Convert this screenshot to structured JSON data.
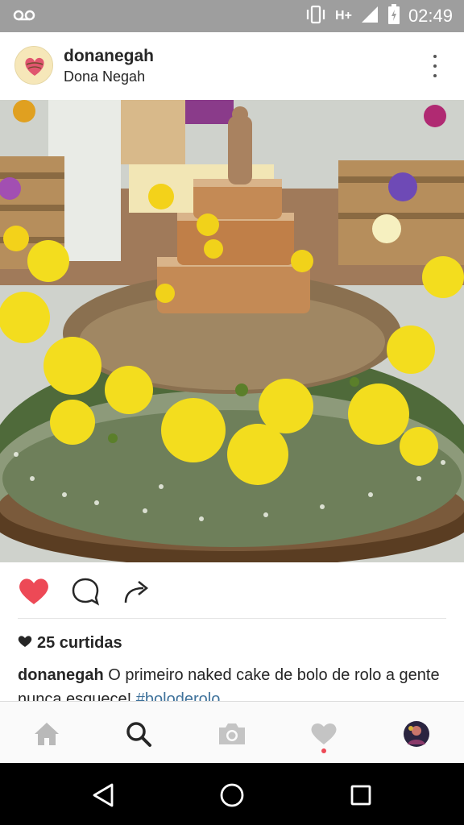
{
  "status_bar": {
    "network": "H+",
    "time": "02:49",
    "icons": [
      "voicemail-icon",
      "vibrate-icon",
      "signal-icon",
      "battery-icon"
    ]
  },
  "post": {
    "username": "donanegah",
    "full_name": "Dona Negah",
    "photo_icon": "cake-photo",
    "liked": true,
    "likes_text": "25 curtidas",
    "caption_user": "donanegah",
    "caption_text": " O primeiro naked cake de bolo de rolo a gente nunca esquece! ",
    "caption_hashtag": "#bolodero​lo"
  },
  "bottom_nav": {
    "items": [
      "home-icon",
      "search-icon",
      "camera-icon",
      "activity-icon",
      "profile-icon"
    ],
    "active": "search-icon"
  },
  "android_nav": {
    "items": [
      "back-icon",
      "home-circle-icon",
      "recents-icon"
    ]
  },
  "colors": {
    "status_bar": "#9e9e9e",
    "like_red": "#ed4956",
    "hashtag": "#3f729b",
    "text": "#262626"
  }
}
